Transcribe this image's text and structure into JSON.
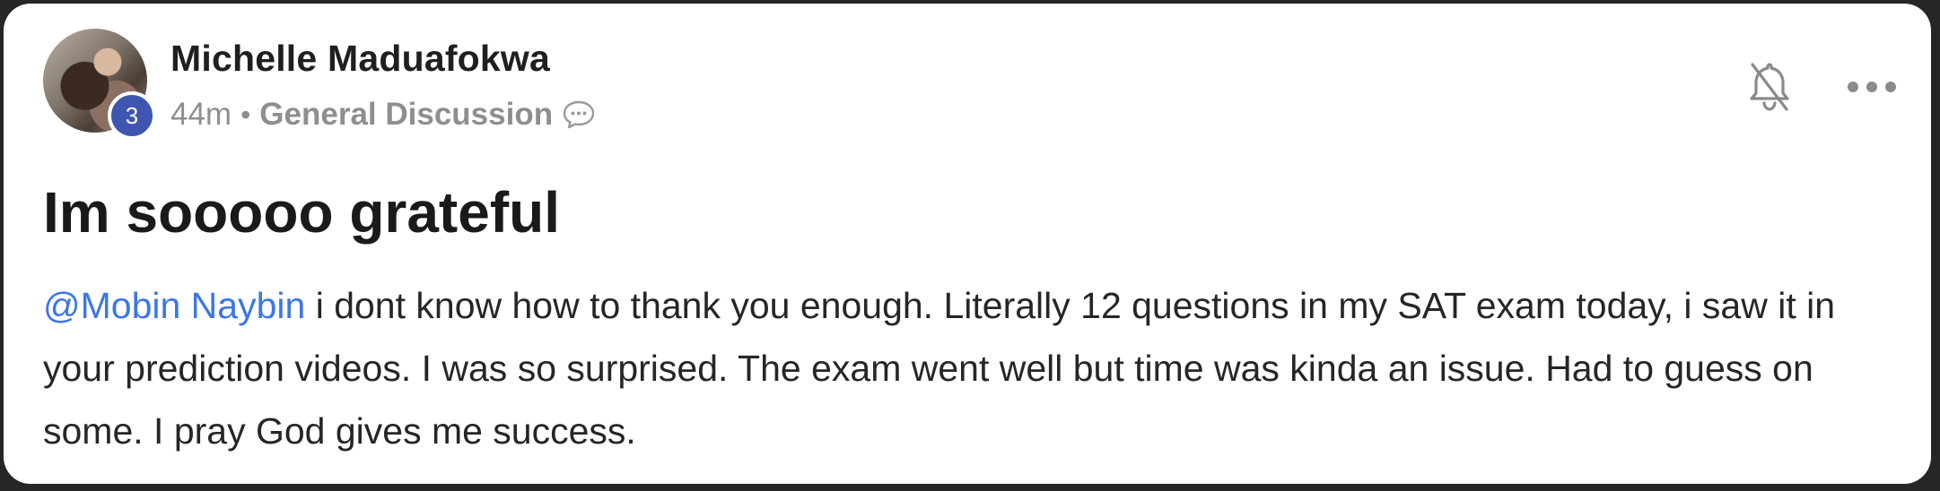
{
  "post": {
    "author": {
      "name": "Michelle Maduafokwa",
      "level": "3",
      "avatar_icon": "user-avatar-photo"
    },
    "meta": {
      "time": "44m",
      "separator": "•",
      "category": "General Discussion",
      "category_icon": "chat-bubble-icon"
    },
    "actions": {
      "notification_icon": "bell-off-icon",
      "more_icon": "more-horizontal-icon"
    },
    "title": "Im sooooo grateful",
    "body": {
      "mention": "@Mobin Naybin",
      "text": " i dont know how to thank you enough. Literally 12 questions in my SAT exam today, i saw it in your prediction videos. I was so surprised. The exam went well but time was kinda an issue. Had to guess on some. I pray God gives me success."
    }
  },
  "colors": {
    "mention": "#3b77e6",
    "level_badge": "#3f56b0",
    "meta_text": "#8e8e8e",
    "background": "#262626",
    "card": "#ffffff"
  }
}
